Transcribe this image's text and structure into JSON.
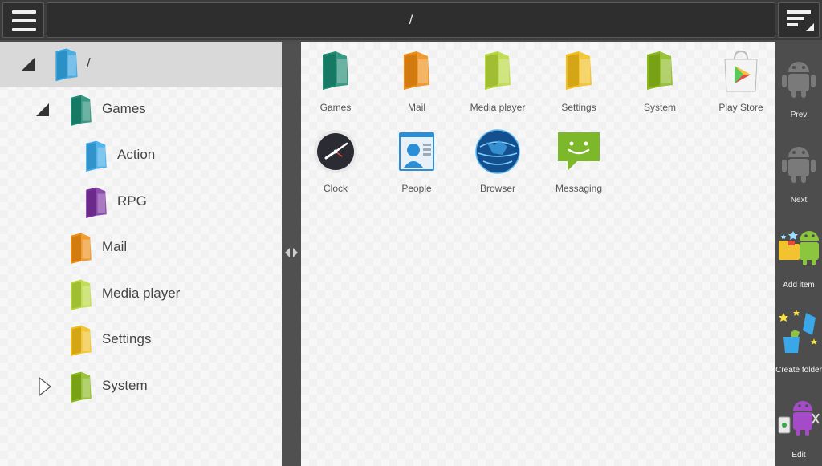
{
  "header": {
    "title": "/"
  },
  "tree": {
    "items": [
      {
        "label": "/",
        "color": "#33a4e0",
        "toggle": "expanded",
        "selected": true
      },
      {
        "label": "Games",
        "color": "#1a8a72",
        "toggle": "expanded"
      },
      {
        "label": "Action",
        "color": "#3aa8e8",
        "toggle": "none"
      },
      {
        "label": "RPG",
        "color": "#7a2fa0",
        "toggle": "none"
      },
      {
        "label": "Mail",
        "color": "#f08c10",
        "toggle": "none"
      },
      {
        "label": "Media player",
        "color": "#b8d83a",
        "toggle": "none"
      },
      {
        "label": "Settings",
        "color": "#f2be1a",
        "toggle": "none"
      },
      {
        "label": "System",
        "color": "#8ab81a",
        "toggle": "collapsed"
      }
    ]
  },
  "grid": {
    "items": [
      {
        "label": "Games",
        "icon": "folder-icon",
        "color": "#1a8a72"
      },
      {
        "label": "Mail",
        "icon": "folder-icon",
        "color": "#f08c10"
      },
      {
        "label": "Media player",
        "icon": "folder-icon",
        "color": "#b8d83a"
      },
      {
        "label": "Settings",
        "icon": "folder-icon",
        "color": "#f2be1a"
      },
      {
        "label": "System",
        "icon": "folder-icon",
        "color": "#8ab81a"
      },
      {
        "label": "Play Store",
        "icon": "play-store-icon"
      },
      {
        "label": "Clock",
        "icon": "clock-icon"
      },
      {
        "label": "People",
        "icon": "people-icon"
      },
      {
        "label": "Browser",
        "icon": "globe-icon"
      },
      {
        "label": "Messaging",
        "icon": "messaging-icon"
      }
    ]
  },
  "actions": {
    "prev": "Prev",
    "next": "Next",
    "add_item": "Add item",
    "create_folder": "Create folder",
    "edit": "Edit"
  }
}
